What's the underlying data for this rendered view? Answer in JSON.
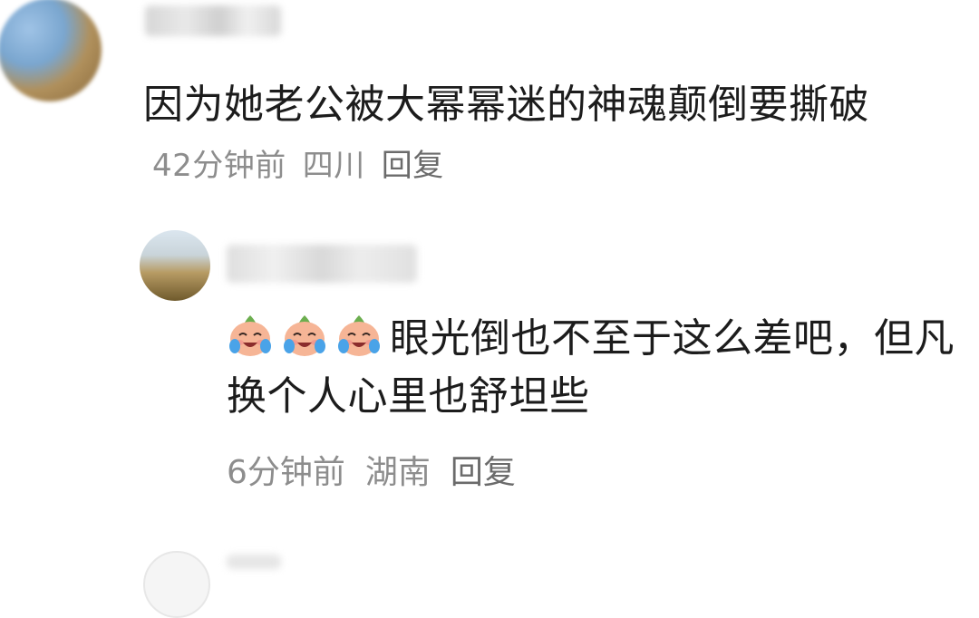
{
  "comments": [
    {
      "text": "因为她老公被大幂幂迷的神魂颠倒要撕破",
      "time": "42分钟前",
      "location": "四川",
      "reply_label": "回复"
    }
  ],
  "reply": {
    "emoji_icon": "crying-laughing-peach-icon",
    "text": "眼光倒也不至于这么差吧，但凡换个人心里也舒坦些",
    "time": "6分钟前",
    "location": "湖南",
    "reply_label": "回复"
  }
}
